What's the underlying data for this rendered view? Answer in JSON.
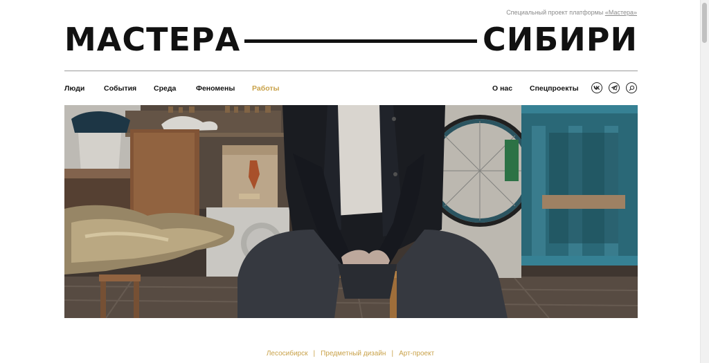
{
  "header": {
    "project_prefix": "Специальный проект платформы ",
    "project_link": "«Мастера»",
    "logo_left": "МАСТЕРА",
    "logo_right": "СИБИРИ"
  },
  "nav": {
    "items": [
      {
        "label": "Люди"
      },
      {
        "label": "События"
      },
      {
        "label": "Среда"
      },
      {
        "label": "Феномены"
      },
      {
        "label": "Работы",
        "active": true
      }
    ],
    "right_items": [
      {
        "label": "О нас"
      },
      {
        "label": "Спецпроекты"
      }
    ],
    "icons": [
      "vk-icon",
      "telegram-icon",
      "search-icon"
    ],
    "accent_color": "#c9a24a"
  },
  "hero": {
    "image": "photo-of-seated-man-in-workshop"
  },
  "tags": {
    "items": [
      "Лесосибирск",
      "Предметный дизайн",
      "Арт-проект"
    ],
    "separator": "|"
  }
}
